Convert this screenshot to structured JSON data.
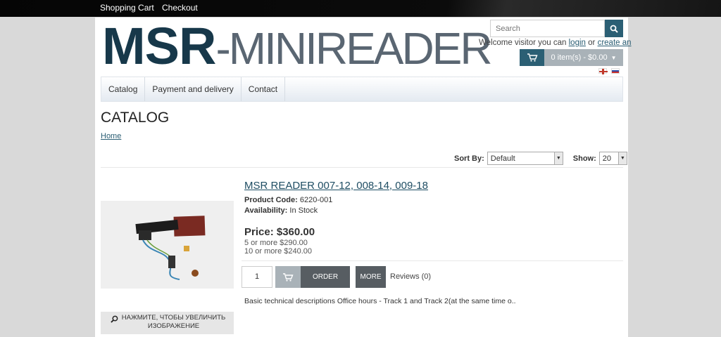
{
  "topbar": {
    "links": [
      "Shopping Cart",
      "Checkout"
    ]
  },
  "header": {
    "logo_bold": "MSR",
    "logo_thin": "-MINIREADER",
    "search_placeholder": "Search",
    "welcome_prefix": "Welcome visitor you can",
    "login_link": "login",
    "welcome_or": "or",
    "create_link": "create an",
    "cart_label": "0 item(s) - $0.00",
    "colors": {
      "accent": "#2b5f74",
      "logo_dark": "#17384a",
      "logo_light": "#5a6672"
    }
  },
  "nav": {
    "items": [
      "Catalog",
      "Payment and delivery",
      "Contact"
    ]
  },
  "page": {
    "title": "CATALOG",
    "breadcrumb": "Home"
  },
  "sort": {
    "sort_label": "Sort By:",
    "sort_value": "Default",
    "show_label": "Show:",
    "show_value": "20"
  },
  "product": {
    "title": "MSR READER 007-12, 008-14, 009-18",
    "code_label": "Product Code:",
    "code_value": "6220-001",
    "availability_label": "Availability:",
    "availability_value": "In Stock",
    "price": "Price: $360.00",
    "tiers": [
      "5 or more $290.00",
      "10 or more $240.00"
    ],
    "quantity": "1",
    "order_label": "ORDER",
    "more_label": "MORE",
    "reviews": "Reviews (0)",
    "description": "Basic technical descriptions   Office hours - Track 1 and Track 2(at the same time o..",
    "zoom_line1": "НАЖМИТЕ, ЧТОБЫ УВЕЛИЧИТЬ",
    "zoom_line2": "ИЗОБРАЖЕНИЕ"
  }
}
